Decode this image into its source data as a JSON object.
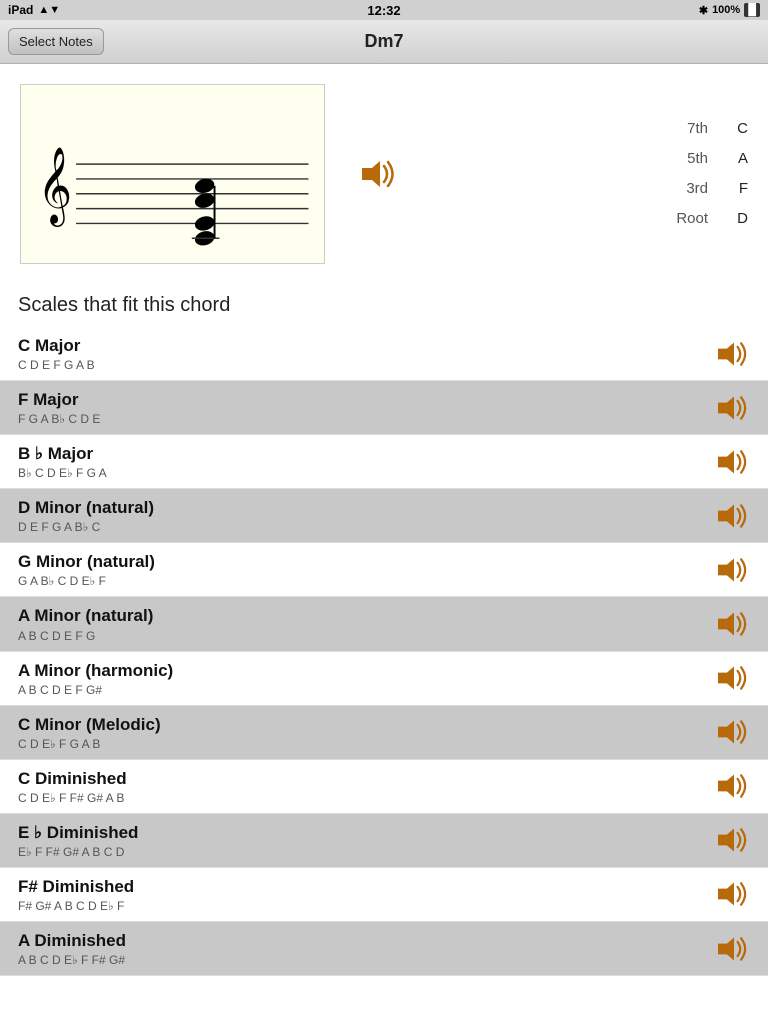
{
  "status": {
    "device": "iPad",
    "time": "12:32",
    "battery": "100%",
    "wifi": true,
    "bluetooth": true
  },
  "nav": {
    "title": "Dm7",
    "back_button_label": "Select Notes"
  },
  "chord": {
    "name": "Dm7",
    "notes": [
      {
        "position": "7th",
        "note": "C"
      },
      {
        "position": "5th",
        "note": "A"
      },
      {
        "position": "3rd",
        "note": "F"
      },
      {
        "position": "Root",
        "note": "D"
      }
    ]
  },
  "scales_header": "Scales that fit this chord",
  "scales": [
    {
      "name": "C Major",
      "notes": "C D E F G A B"
    },
    {
      "name": "F Major",
      "notes": "F G A B♭ C D E"
    },
    {
      "name": "B ♭ Major",
      "notes": "B♭ C D E♭ F G A"
    },
    {
      "name": "D Minor (natural)",
      "notes": "D E F G A B♭ C"
    },
    {
      "name": "G Minor (natural)",
      "notes": "G A B♭ C D E♭ F"
    },
    {
      "name": "A Minor (natural)",
      "notes": "A B C D E F G"
    },
    {
      "name": "A Minor (harmonic)",
      "notes": "A B C D E F G#"
    },
    {
      "name": "C Minor (Melodic)",
      "notes": "C D E♭ F G A B"
    },
    {
      "name": "C Diminished",
      "notes": "C D E♭ F F# G# A B"
    },
    {
      "name": "E ♭ Diminished",
      "notes": "E♭ F F# G# A B C D"
    },
    {
      "name": "F# Diminished",
      "notes": "F# G# A B C D E♭ F"
    },
    {
      "name": "A Diminished",
      "notes": "A B C D E♭ F F# G#"
    }
  ],
  "icons": {
    "speaker_unicode": "🔊",
    "bluetooth_unicode": "✦",
    "wifi_unicode": "▲"
  }
}
